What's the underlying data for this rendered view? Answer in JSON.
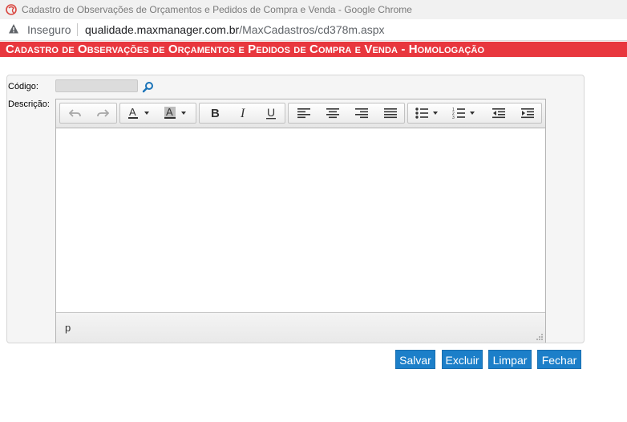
{
  "browser": {
    "window_title": "Cadastro de Observações de Orçamentos e Pedidos de Compra e Venda - Google Chrome",
    "security_label": "Inseguro",
    "url_host": "qualidade.maxmanager.com.br",
    "url_path": "/MaxCadastros/cd378m.aspx",
    "icons": {
      "app": "chrome-app-icon",
      "security": "warning-triangle-icon"
    }
  },
  "page": {
    "header": "Cadastro de Observações de Orçamentos e Pedidos de Compra e Venda  - Homologação",
    "header_color": "#e8373e"
  },
  "form": {
    "codigo_label": "Código:",
    "codigo_value": "",
    "descricao_label": "Descrição:",
    "lookup_icon": "search-magnifier-icon"
  },
  "editor": {
    "toolbar": [
      "undo",
      "redo",
      "text-color",
      "background-color",
      "bold",
      "italic",
      "underline",
      "align-left",
      "align-center",
      "align-right",
      "align-justify",
      "bullet-list",
      "numbered-list",
      "outdent",
      "indent"
    ],
    "content": "",
    "status_path": "p"
  },
  "actions": {
    "save": "Salvar",
    "delete": "Excluir",
    "clear": "Limpar",
    "close": "Fechar",
    "button_color": "#1c7fc9"
  }
}
